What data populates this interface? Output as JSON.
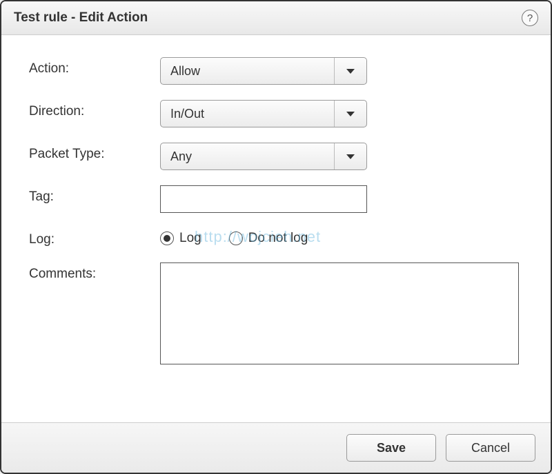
{
  "dialog": {
    "title": "Test rule - Edit Action"
  },
  "form": {
    "action": {
      "label": "Action:",
      "value": "Allow"
    },
    "direction": {
      "label": "Direction:",
      "value": "In/Out"
    },
    "packet_type": {
      "label": "Packet Type:",
      "value": "Any"
    },
    "tag": {
      "label": "Tag:",
      "value": ""
    },
    "log": {
      "label": "Log:",
      "options": {
        "log": "Log",
        "do_not_log": "Do not log"
      },
      "selected": "log"
    },
    "comments": {
      "label": "Comments:",
      "value": ""
    }
  },
  "buttons": {
    "save": "Save",
    "cancel": "Cancel"
  },
  "watermark": "http://wojcieh.net"
}
